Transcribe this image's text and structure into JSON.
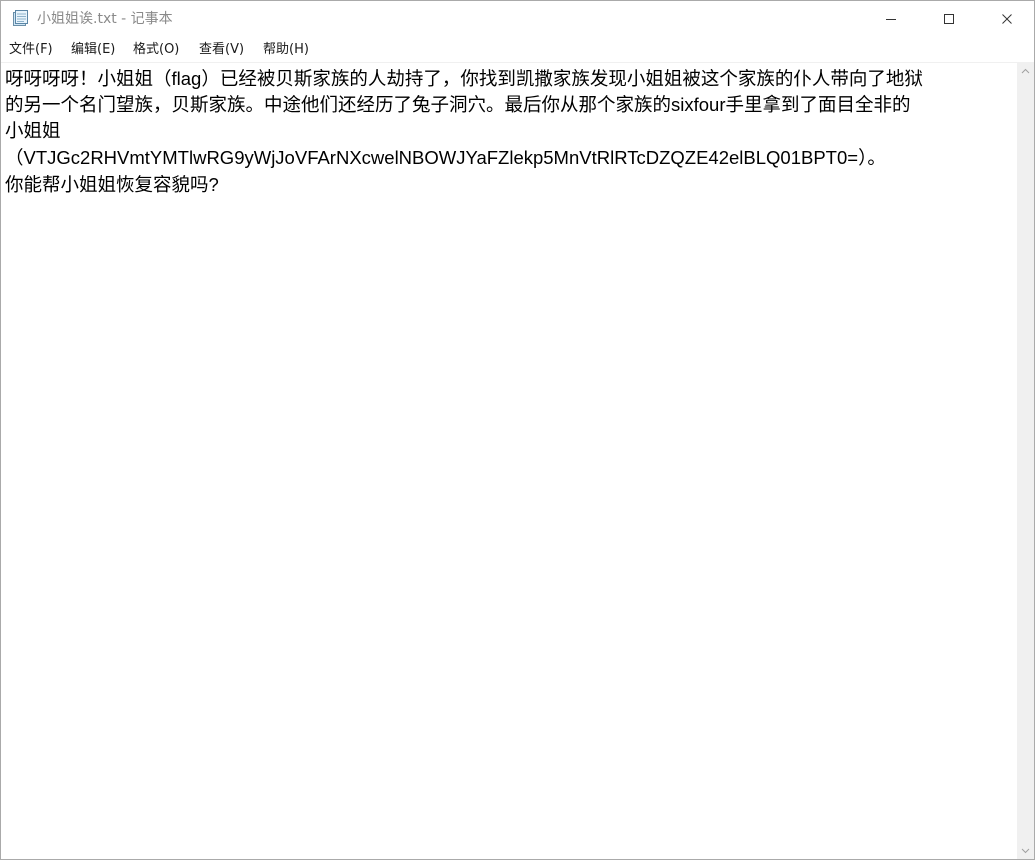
{
  "window": {
    "title": "小姐姐诶.txt - 记事本"
  },
  "menu": {
    "file": "文件(F)",
    "edit": "编辑(E)",
    "format": "格式(O)",
    "view": "查看(V)",
    "help": "帮助(H)"
  },
  "editor": {
    "lines": [
      "呀呀呀呀！小姐姐（flag）已经被贝斯家族的人劫持了，你找到凯撒家族发现小姐姐被这个家族的仆人带向了地狱",
      "的另一个名门望族，贝斯家族。中途他们还经历了兔子洞穴。最后你从那个家族的sixfour手里拿到了面目全非的",
      "小姐姐",
      "（VTJGc2RHVmtYMTlwRG9yWjJoVFArNXcwelNBOWJYaFZlekp5MnVtRlRTcDZQZE42elBLQ01BPT0=）。",
      "你能帮小姐姐恢复容貌吗?"
    ]
  },
  "colors": {
    "title_text": "#8a8a8a",
    "menu_text": "#1a1a1a",
    "editor_text": "#000000",
    "scrollbar": "#f0f0f0"
  },
  "icons": {
    "app": "notepad-icon",
    "minimize": "minimize-icon",
    "maximize": "maximize-icon",
    "close": "close-icon",
    "scroll_up": "chevron-up-icon",
    "scroll_down": "chevron-down-icon"
  }
}
